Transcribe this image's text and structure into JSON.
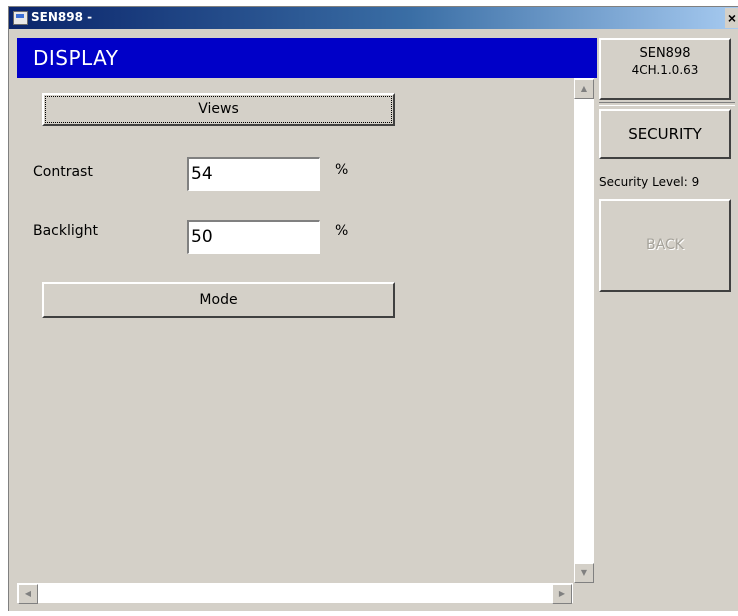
{
  "window": {
    "title": "SEN898 -",
    "close_glyph": "×"
  },
  "header": {
    "title": "DISPLAY"
  },
  "form": {
    "views_button": "Views",
    "contrast_label": "Contrast",
    "contrast_value": "54",
    "contrast_unit": "%",
    "backlight_label": "Backlight",
    "backlight_value": "50",
    "backlight_unit": "%",
    "mode_button": "Mode"
  },
  "sidebar": {
    "device_name": "SEN898",
    "firmware": "4CH.1.0.63",
    "security_button": "SECURITY",
    "security_level": "Security Level: 9",
    "back_button": "BACK"
  },
  "scrollbars": {
    "up_glyph": "▲",
    "down_glyph": "▼",
    "left_glyph": "◀",
    "right_glyph": "▶"
  },
  "colors": {
    "header_bg": "#0000c8",
    "window_bg": "#d4d0c8",
    "titlebar_start": "#0a246a"
  }
}
